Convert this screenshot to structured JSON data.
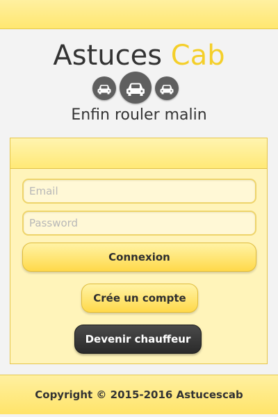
{
  "header": {
    "logo_main": "Astuces",
    "logo_accent": "Cab",
    "tagline": "Enfin rouler malin",
    "icons": [
      "car-icon",
      "car-icon",
      "car-icon"
    ]
  },
  "login": {
    "email_placeholder": "Email",
    "password_placeholder": "Password",
    "connexion_label": "Connexion",
    "create_account_label": "Crée un compte",
    "become_driver_label": "Devenir chauffeur"
  },
  "footer": {
    "copyright": "Copyright © 2015-2016 Astucescab"
  },
  "colors": {
    "accent": "#f4cf2a",
    "panel": "#fff4ba",
    "dark_button": "#333333"
  }
}
